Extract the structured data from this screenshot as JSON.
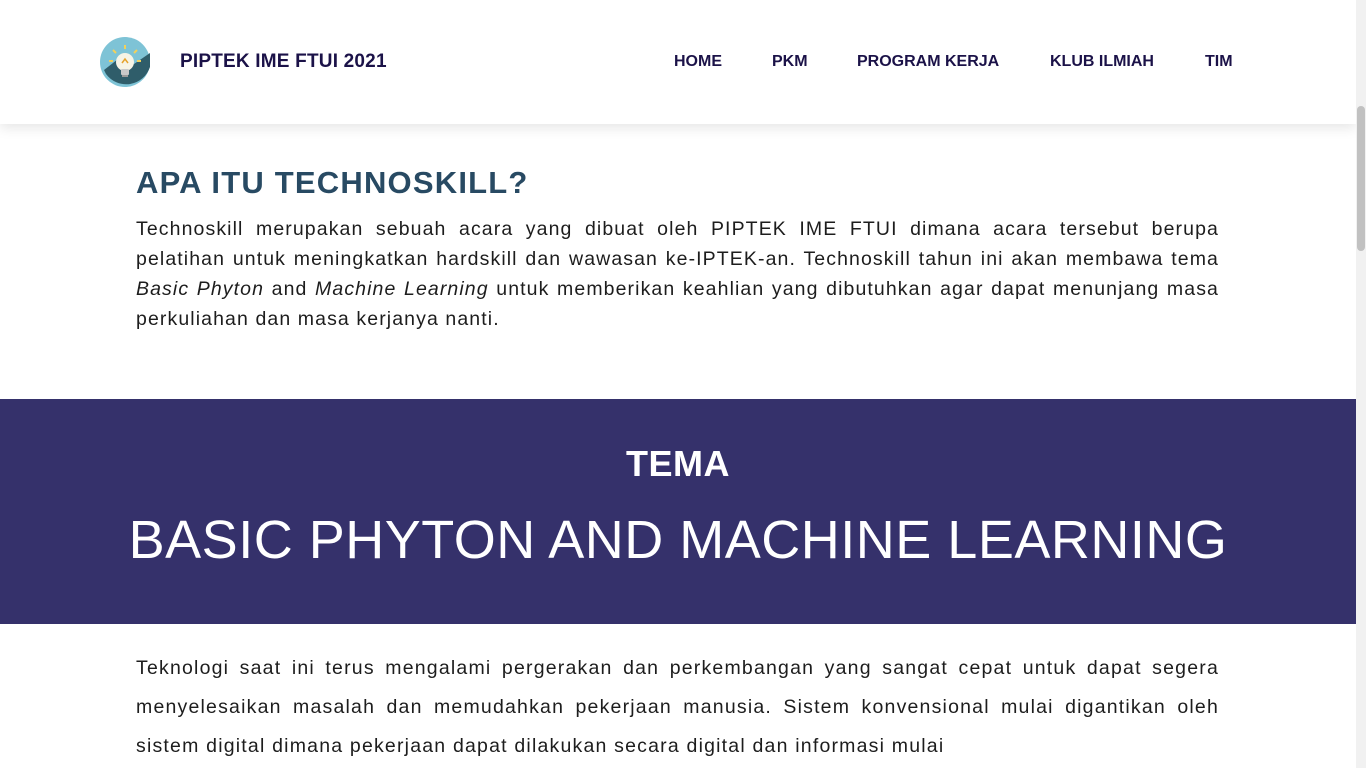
{
  "header": {
    "brand": "PIPTEK IME FTUI 2021",
    "logo_icon": "lightbulb-logo-icon",
    "nav": [
      "HOME",
      "PKM",
      "PROGRAM KERJA",
      "KLUB ILMIAH",
      "TIM"
    ]
  },
  "intro": {
    "title": "APA ITU TECHNOSKILL?",
    "part1": "Technoskill merupakan sebuah acara yang dibuat oleh PIPTEK IME FTUI dimana acara tersebut berupa pelatihan untuk meningkatkan hardskill dan wawasan ke-IPTEK-an. Technoskill tahun ini akan membawa tema ",
    "italic1": "Basic Phyton",
    "part2": " and ",
    "italic2": "Machine Learning",
    "part3": " untuk memberikan keahlian yang dibutuhkan agar dapat menunjang masa perkuliahan dan masa kerjanya nanti."
  },
  "theme": {
    "label": "TEMA",
    "value": "BASIC PHYTON AND MACHINE LEARNING"
  },
  "body": {
    "paragraph": "Teknologi saat ini terus mengalami pergerakan dan perkembangan yang sangat cepat untuk dapat segera menyelesaikan masalah dan memudahkan pekerjaan manusia. Sistem konvensional mulai digantikan oleh sistem digital dimana pekerjaan dapat dilakukan secara digital dan informasi mulai"
  },
  "colors": {
    "brand_navy": "#1b1248",
    "heading_blue": "#284a63",
    "theme_band": "#35316b"
  }
}
